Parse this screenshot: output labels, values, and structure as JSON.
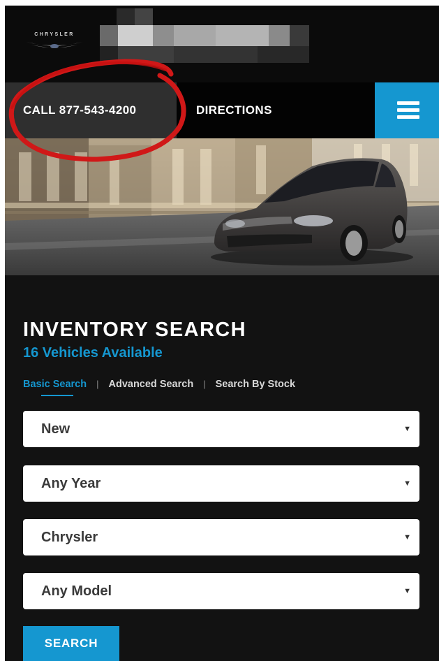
{
  "header": {
    "brand_wordmark": "CHRYSLER"
  },
  "nav": {
    "call_label": "CALL 877-543-4200",
    "directions_label": "DIRECTIONS",
    "menu_icon": "hamburger-menu-icon"
  },
  "inventory": {
    "title": "INVENTORY SEARCH",
    "count_text": "16 Vehicles Available",
    "tabs": [
      {
        "label": "Basic Search",
        "active": true
      },
      {
        "label": "Advanced Search",
        "active": false
      },
      {
        "label": "Search By Stock",
        "active": false
      }
    ],
    "tab_separator": "|",
    "selects": [
      {
        "value": "New"
      },
      {
        "value": "Any Year"
      },
      {
        "value": "Chrysler"
      },
      {
        "value": "Any Model"
      }
    ],
    "dropdown_glyph": "▼",
    "search_label": "SEARCH"
  },
  "colors": {
    "accent": "#1597d0",
    "background": "#121212",
    "annotation": "#d01818"
  }
}
